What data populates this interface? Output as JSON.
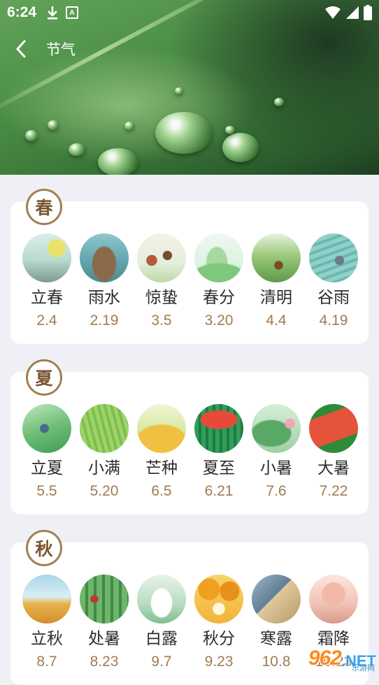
{
  "status_bar": {
    "time": "6:24"
  },
  "header": {
    "title": "节气"
  },
  "seasons": [
    {
      "name": "春",
      "terms": [
        {
          "name": "立春",
          "date": "2.4"
        },
        {
          "name": "雨水",
          "date": "2.19"
        },
        {
          "name": "惊蛰",
          "date": "3.5"
        },
        {
          "name": "春分",
          "date": "3.20"
        },
        {
          "name": "清明",
          "date": "4.4"
        },
        {
          "name": "谷雨",
          "date": "4.19"
        }
      ]
    },
    {
      "name": "夏",
      "terms": [
        {
          "name": "立夏",
          "date": "5.5"
        },
        {
          "name": "小满",
          "date": "5.20"
        },
        {
          "name": "芒种",
          "date": "6.5"
        },
        {
          "name": "夏至",
          "date": "6.21"
        },
        {
          "name": "小暑",
          "date": "7.6"
        },
        {
          "name": "大暑",
          "date": "7.22"
        }
      ]
    },
    {
      "name": "秋",
      "terms": [
        {
          "name": "立秋",
          "date": "8.7"
        },
        {
          "name": "处暑",
          "date": "8.23"
        },
        {
          "name": "白露",
          "date": "9.7"
        },
        {
          "name": "秋分",
          "date": "9.23"
        },
        {
          "name": "寒露",
          "date": "10.8"
        },
        {
          "name": "霜降",
          "date": "10.23"
        }
      ]
    }
  ],
  "watermark": {
    "number": "962",
    "suffix": ".NET",
    "sub": "乐游网"
  }
}
